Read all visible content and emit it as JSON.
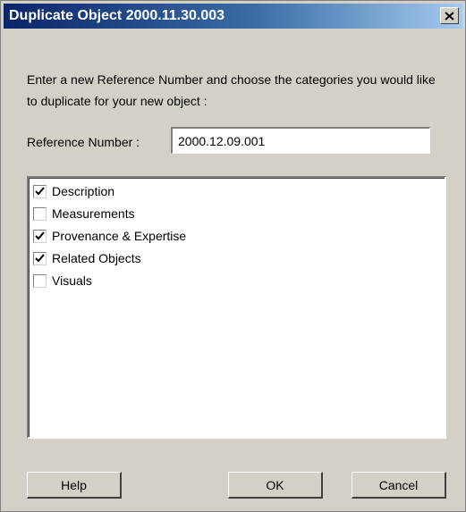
{
  "dialog": {
    "title": "Duplicate Object 2000.11.30.003",
    "close_label": "×",
    "instructions": "Enter a new Reference Number and choose the categories you would like to duplicate for your new object :",
    "reference": {
      "label": "Reference Number :",
      "value": "2000.12.09.001"
    },
    "categories": [
      {
        "label": "Description",
        "checked": true
      },
      {
        "label": "Measurements",
        "checked": false
      },
      {
        "label": "Provenance & Expertise",
        "checked": true
      },
      {
        "label": "Related Objects",
        "checked": true
      },
      {
        "label": "Visuals",
        "checked": false
      }
    ],
    "buttons": {
      "help": "Help",
      "ok": "OK",
      "cancel": "Cancel"
    }
  },
  "colors": {
    "title_start": "#0a246a",
    "title_end": "#a6caf0",
    "face": "#d4d0c8"
  },
  "icons": {
    "close": "close-icon",
    "check": "checkmark-icon"
  }
}
